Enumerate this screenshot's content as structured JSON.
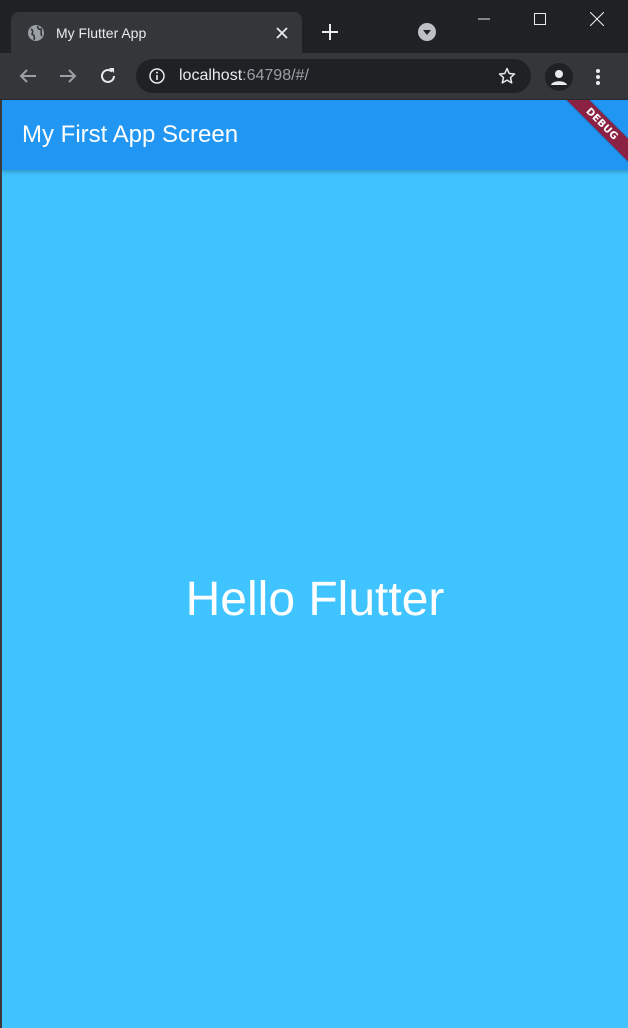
{
  "browser": {
    "tab": {
      "title": "My Flutter App",
      "favicon_icon": "globe-icon"
    },
    "address_bar": {
      "host": "localhost",
      "path": ":64798/#/"
    },
    "icons": {
      "close_tab": "close-icon",
      "new_tab": "plus-icon",
      "tab_search": "chevron-down-icon",
      "minimize": "minimize-icon",
      "maximize": "maximize-icon",
      "close_window": "close-icon",
      "back": "arrow-left-icon",
      "forward": "arrow-right-icon",
      "reload": "reload-icon",
      "site_info": "info-icon",
      "bookmark": "star-icon",
      "profile": "person-icon",
      "menu": "more-vert-icon"
    }
  },
  "app": {
    "appbar_title": "My First App Screen",
    "debug_banner": "DEBUG",
    "body_text": "Hello Flutter",
    "colors": {
      "appbar": "#2196f3",
      "background": "#40c4ff",
      "debug_banner": "#8b2143",
      "text": "#ffffff"
    }
  }
}
